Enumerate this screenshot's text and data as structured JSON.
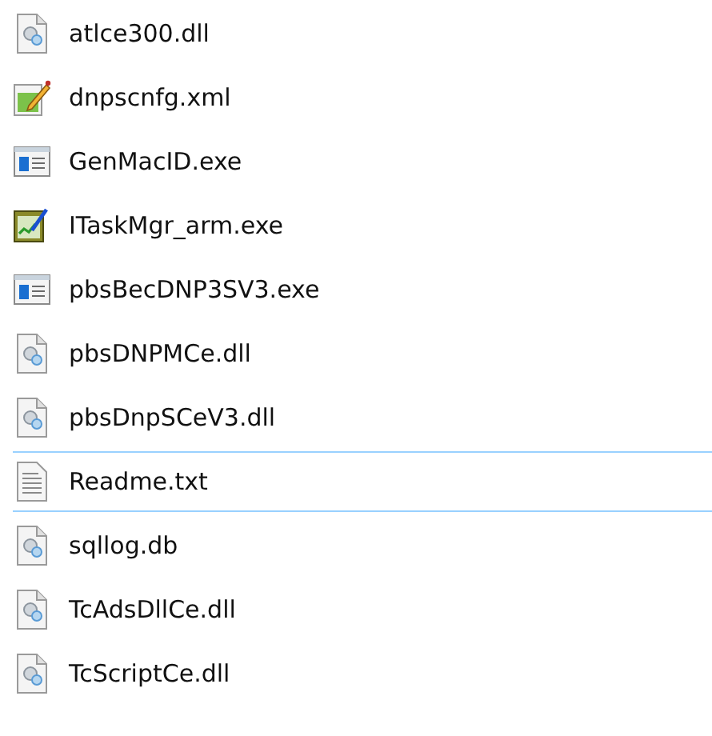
{
  "files": [
    {
      "name": "atlce300.dll",
      "kind": "dll",
      "focused": false
    },
    {
      "name": "dnpscnfg.xml",
      "kind": "xml",
      "focused": false
    },
    {
      "name": "GenMacID.exe",
      "kind": "exe",
      "focused": false
    },
    {
      "name": "ITaskMgr_arm.exe",
      "kind": "app",
      "focused": false
    },
    {
      "name": "pbsBecDNP3SV3.exe",
      "kind": "exe",
      "focused": false
    },
    {
      "name": "pbsDNPMCe.dll",
      "kind": "dll",
      "focused": false
    },
    {
      "name": "pbsDnpSCeV3.dll",
      "kind": "dll",
      "focused": false
    },
    {
      "name": "Readme.txt",
      "kind": "txt",
      "focused": true
    },
    {
      "name": "sqllog.db",
      "kind": "dll",
      "focused": false
    },
    {
      "name": "TcAdsDllCe.dll",
      "kind": "dll",
      "focused": false
    },
    {
      "name": "TcScriptCe.dll",
      "kind": "dll",
      "focused": false
    }
  ]
}
